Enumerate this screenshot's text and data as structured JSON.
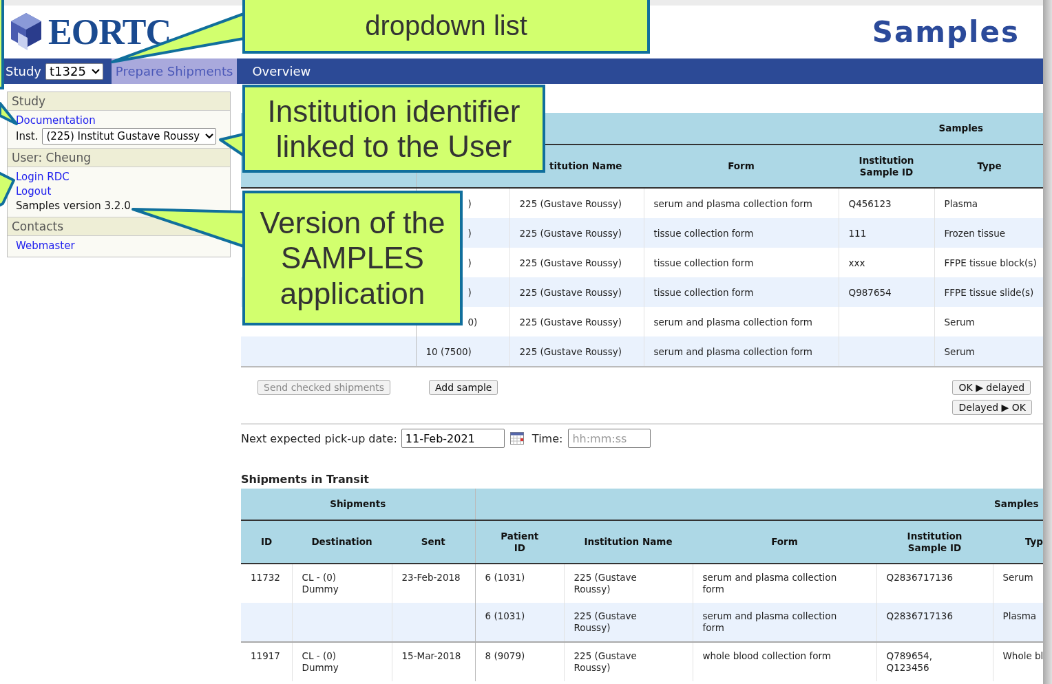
{
  "header": {
    "logo_text": "EORTC",
    "app_title": "Samples"
  },
  "nav": {
    "study_label": "Study",
    "study_select": "t1325",
    "tabs": [
      {
        "label": "Prepare Shipments",
        "selected": true
      },
      {
        "label": "Overview",
        "selected": false
      }
    ]
  },
  "sidebar": {
    "sections": [
      {
        "title": "Study",
        "items": [
          {
            "kind": "link",
            "text": "Documentation"
          },
          {
            "kind": "select",
            "label": "Inst.",
            "value": "(225) Institut Gustave Roussy"
          }
        ]
      },
      {
        "title": "User: Cheung",
        "items": [
          {
            "kind": "link",
            "text": "Login RDC"
          },
          {
            "kind": "link",
            "text": "Logout"
          },
          {
            "kind": "text",
            "text": "Samples version 3.2.0"
          }
        ]
      },
      {
        "title": "Contacts",
        "items": [
          {
            "kind": "link",
            "text": "Webmaster"
          }
        ]
      }
    ]
  },
  "preparation": {
    "group_header": "Samples",
    "columns": [
      "titution Name",
      "Form",
      "Institution Sample ID",
      "Type"
    ],
    "rows": [
      {
        "patient_id_visible_part": ")",
        "institution": "225 (Gustave Roussy)",
        "form": "serum and plasma collection form",
        "sample_id": "Q456123",
        "type": "Plasma"
      },
      {
        "patient_id_visible_part": ")",
        "institution": "225 (Gustave Roussy)",
        "form": "tissue collection form",
        "sample_id": "111",
        "type": "Frozen tissue"
      },
      {
        "patient_id_visible_part": ")",
        "institution": "225 (Gustave Roussy)",
        "form": "tissue collection form",
        "sample_id": "xxx",
        "type": "FFPE tissue block(s)"
      },
      {
        "patient_id_visible_part": ")",
        "institution": "225 (Gustave Roussy)",
        "form": "tissue collection form",
        "sample_id": "Q987654",
        "type": "FFPE tissue slide(s)"
      },
      {
        "patient_id_visible_part": "0)",
        "institution": "225 (Gustave Roussy)",
        "form": "serum and plasma collection form",
        "type": "Serum"
      },
      {
        "patient_id": "10 (7500)",
        "institution": "225 (Gustave Roussy)",
        "form": "serum and plasma collection form",
        "type": "Serum"
      }
    ],
    "buttons": [
      {
        "label": "Send checked shipments",
        "disabled": true
      },
      {
        "label": "Add sample",
        "disabled": false
      }
    ],
    "status_buttons": [
      "OK ▶ delayed",
      "Delayed ▶ OK"
    ]
  },
  "pickup": {
    "label": "Next expected pick-up date:",
    "date": "11-Feb-2021",
    "time_label": "Time:",
    "time_placeholder": "hh:mm:ss"
  },
  "transit": {
    "title": "Shipments in Transit",
    "group_headers": [
      "Shipments",
      "Samples"
    ],
    "columns": [
      "ID",
      "Destination",
      "Sent",
      "Patient ID",
      "Institution Name",
      "Form",
      "Institution Sample ID",
      "Typ"
    ],
    "rows": [
      {
        "id": "11732",
        "destination": "CL - (0) Dummy",
        "sent": "23-Feb-2018",
        "patient_id": "6 (1031)",
        "institution": "225 (Gustave Roussy)",
        "form": "serum and plasma collection form",
        "sample_id": "Q2836717136",
        "type": "Serum"
      },
      {
        "patient_id": "6 (1031)",
        "institution": "225 (Gustave Roussy)",
        "form": "serum and plasma collection form",
        "sample_id": "Q2836717136",
        "type": "Plasma"
      },
      {
        "id": "11917",
        "destination": "CL - (0) Dummy",
        "sent": "15-Mar-2018",
        "patient_id": "8 (9079)",
        "institution": "225 (Gustave Roussy)",
        "form": "whole blood collection form",
        "sample_id": "Q789654, Q123456",
        "type": "Whole bl"
      }
    ]
  },
  "callouts": [
    {
      "text": "dropdown list"
    },
    {
      "text": "Institution identifier linked to the User"
    },
    {
      "text": "Version of the SAMPLES application"
    }
  ]
}
